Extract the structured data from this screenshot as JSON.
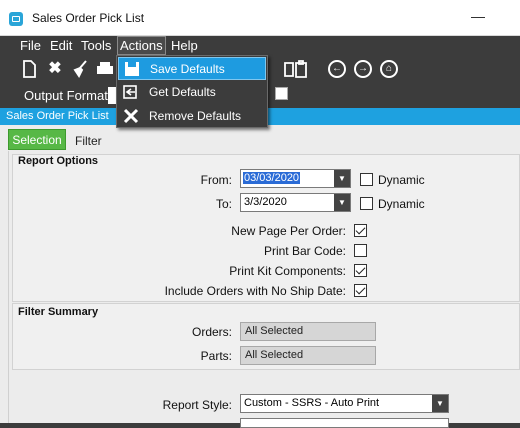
{
  "window": {
    "title": "Sales Order Pick List"
  },
  "menu": {
    "file": "File",
    "edit": "Edit",
    "tools": "Tools",
    "actions": "Actions",
    "help": "Help"
  },
  "actions_menu": {
    "items": [
      "Save Defaults",
      "Get Defaults",
      "Remove Defaults"
    ]
  },
  "output": {
    "label": "Output Format:"
  },
  "bluebar": {
    "label": "Sales Order Pick List"
  },
  "tabs": {
    "selection": "Selection",
    "filter": "Filter"
  },
  "report_options": {
    "title": "Report Options",
    "from_label": "From:",
    "from_value": "03/03/2020",
    "to_label": "To:",
    "to_value": "3/3/2020",
    "dynamic_label": "Dynamic",
    "new_page_label": "New Page Per Order:",
    "new_page_checked": true,
    "print_bar_code_label": "Print Bar Code:",
    "print_bar_code_checked": false,
    "print_kit_label": "Print Kit Components:",
    "print_kit_checked": true,
    "include_orders_label": "Include Orders with No Ship Date:",
    "include_orders_checked": true
  },
  "filter_summary": {
    "title": "Filter Summary",
    "orders_label": "Orders:",
    "orders_value": "All Selected",
    "parts_label": "Parts:",
    "parts_value": "All Selected"
  },
  "report_style": {
    "label": "Report Style:",
    "value": "Custom - SSRS - Auto Print"
  },
  "colors": {
    "accent_blue": "#1ea1e0",
    "tab_green": "#57b846",
    "toolbar_dark": "#3c3c3c"
  }
}
